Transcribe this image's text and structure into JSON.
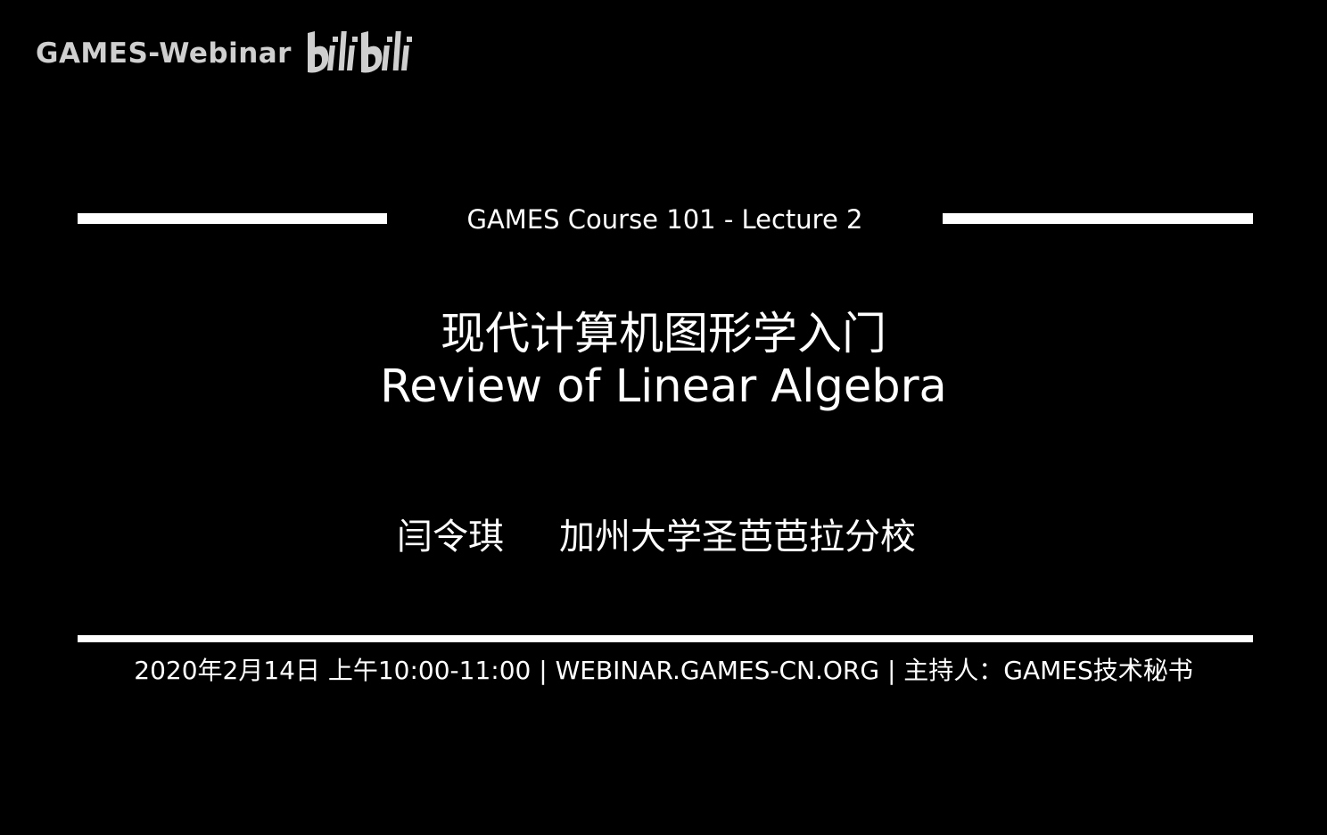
{
  "watermark": {
    "channel": "GAMES-Webinar",
    "logo_text": "bilibili",
    "logo_icon": "bilibili-logo-icon"
  },
  "slide": {
    "course_label": "GAMES Course 101 - Lecture 2",
    "title_zh": "现代计算机图形学入门",
    "title_en": "Review of Linear Algebra",
    "presenter": "闫令琪",
    "affiliation": "加州大学圣芭芭拉分校",
    "event_info": "2020年2月14日 上午10:00-11:00 | WEBINAR.GAMES-CN.ORG | 主持人：GAMES技术秘书"
  },
  "colors": {
    "background": "#000000",
    "text": "#ffffff",
    "watermark": "#cfcfcf"
  }
}
